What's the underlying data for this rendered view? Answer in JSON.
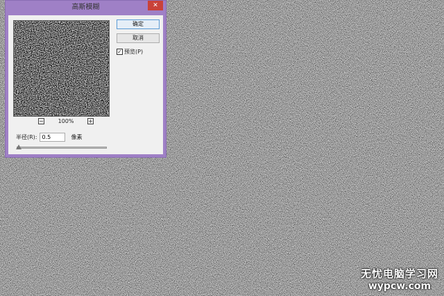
{
  "dialog": {
    "title": "高斯模糊",
    "close_label": "✕",
    "ok_label": "确定",
    "cancel_label": "取消",
    "preview_label": "预览(P)",
    "preview_checked": true,
    "zoom_out": "−",
    "zoom_level": "100%",
    "zoom_in": "+",
    "radius_label": "半径(R):",
    "radius_value": "0.5",
    "radius_unit": "像素",
    "slider_value": 0.5
  },
  "watermark": {
    "line1": "无忧电脑学习网",
    "line2": "wypcw.com"
  },
  "colors": {
    "titlebar": "#9f80c6",
    "close": "#c9423a"
  }
}
